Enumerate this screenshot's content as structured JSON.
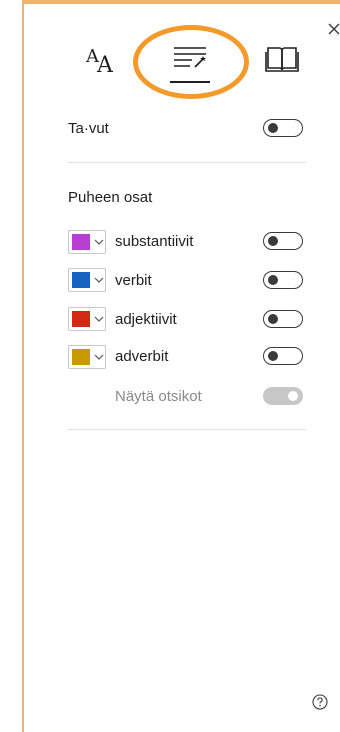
{
  "tabs": {
    "text_options": "text-options",
    "grammar_options": "grammar-options",
    "reading_preferences": "reading-preferences",
    "active": "grammar_options"
  },
  "syllables": {
    "label": "Ta·vut",
    "on": false
  },
  "parts_of_speech": {
    "title": "Puheen osat",
    "items": [
      {
        "label": "substantiivit",
        "color": "#b83fd1",
        "on": false
      },
      {
        "label": "verbit",
        "color": "#1565c0",
        "on": false
      },
      {
        "label": "adjektiivit",
        "color": "#d12a12",
        "on": false
      },
      {
        "label": "adverbit",
        "color": "#c99a00",
        "on": false
      }
    ],
    "show_labels": {
      "label": "Näytä otsikot",
      "on": true,
      "disabled": true
    }
  },
  "colors": {
    "highlight": "#f49a2a",
    "panel_edge": "#f0b46a"
  }
}
